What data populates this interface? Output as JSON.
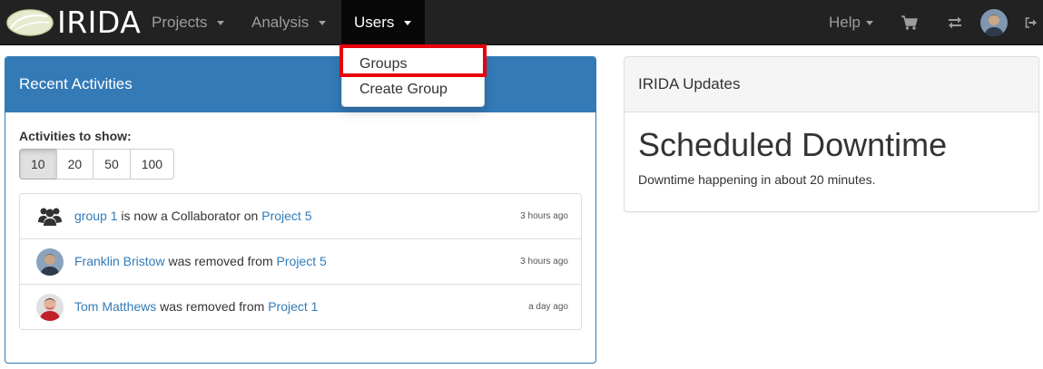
{
  "navbar": {
    "brand": "IRIDA",
    "items": [
      {
        "label": "Projects"
      },
      {
        "label": "Analysis"
      },
      {
        "label": "Users"
      }
    ],
    "help_label": "Help",
    "icons": [
      "cart-icon",
      "exchange-icon",
      "user-avatar",
      "logout-icon"
    ]
  },
  "users_menu": {
    "items": [
      {
        "label": "Groups"
      },
      {
        "label": "Create Group"
      }
    ]
  },
  "recent_activities": {
    "title": "Recent Activities",
    "show_label": "Activities to show:",
    "counts": [
      "10",
      "20",
      "50",
      "100"
    ],
    "selected_count": "10",
    "activities": [
      {
        "icon": "users-group-icon",
        "subject": "group 1",
        "verb": "is now a Collaborator on",
        "object": "Project 5",
        "time": "3 hours ago"
      },
      {
        "icon": "user-avatar",
        "subject": "Franklin Bristow",
        "verb": "was removed from",
        "object": "Project 5",
        "time": "3 hours ago"
      },
      {
        "icon": "user-avatar",
        "subject": "Tom Matthews",
        "verb": "was removed from",
        "object": "Project 1",
        "time": "a day ago"
      }
    ]
  },
  "updates": {
    "title": "IRIDA Updates",
    "headline": "Scheduled Downtime",
    "text": "Downtime happening in about 20 minutes."
  },
  "colors": {
    "navbar_bg": "#222222",
    "primary": "#337ab7",
    "highlight": "#e8000b"
  }
}
